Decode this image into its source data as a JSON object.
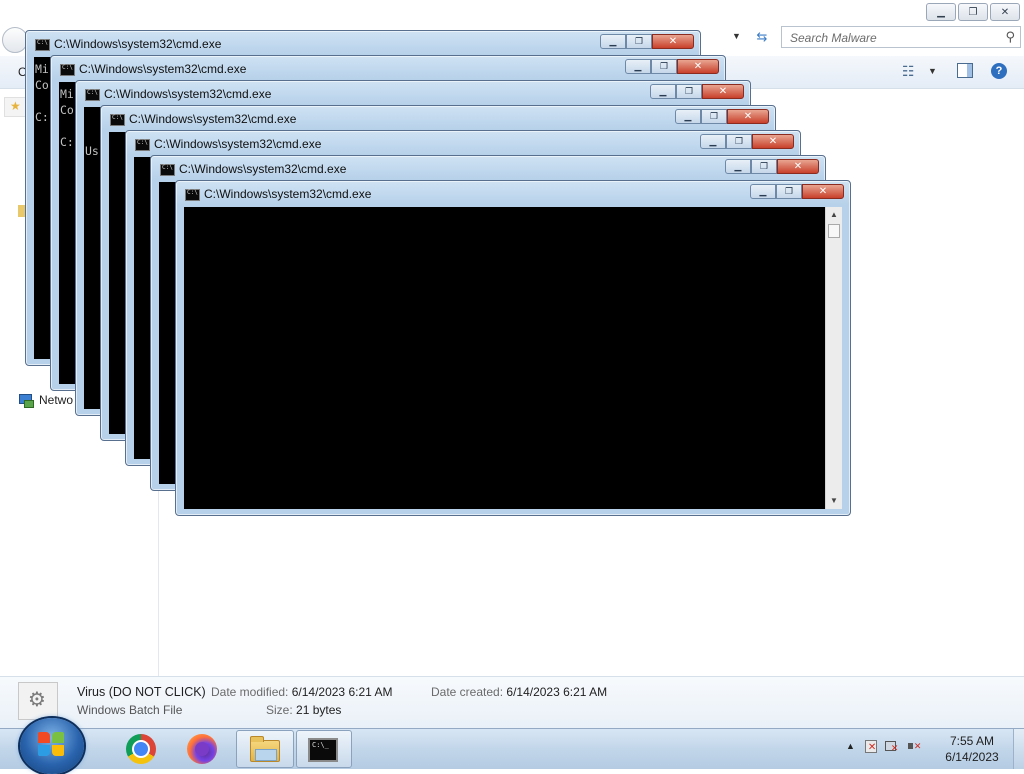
{
  "explorer": {
    "search_placeholder": "Search Malware",
    "toolbar_org": "O",
    "nav_network": "Netwo",
    "window_controls": {
      "minimize": "▁",
      "maximize": "❐",
      "close": "✕"
    },
    "details": {
      "name": "Virus (DO NOT CLICK)",
      "type": "Windows Batch File",
      "date_modified_label": "Date modified:",
      "date_modified": "6/14/2023 6:21 AM",
      "size_label": "Size:",
      "size": "21 bytes",
      "date_created_label": "Date created:",
      "date_created": "6/14/2023 6:21 AM"
    }
  },
  "cmd_windows": [
    {
      "title": "C:\\Windows\\system32\\cmd.exe",
      "lines": [
        "Mi",
        "Co",
        "",
        "C:"
      ]
    },
    {
      "title": "C:\\Windows\\system32\\cmd.exe",
      "lines": [
        "Mi",
        "Co",
        "",
        "C:"
      ]
    },
    {
      "title": "C:\\Windows\\system32\\cmd.exe",
      "lines": [
        "",
        "",
        "Us"
      ]
    },
    {
      "title": "C:\\Windows\\system32\\cmd.exe",
      "lines": []
    },
    {
      "title": "C:\\Windows\\system32\\cmd.exe",
      "lines": []
    },
    {
      "title": "C:\\Windows\\system32\\cmd.exe",
      "lines": []
    },
    {
      "title": "C:\\Windows\\system32\\cmd.exe",
      "lines": []
    }
  ],
  "cmd_controls": {
    "minimize": "▁",
    "maximize": "❐",
    "close": "✕"
  },
  "taskbar": {
    "apps": [
      {
        "name": "Google Chrome",
        "icon": "chrome-icon"
      },
      {
        "name": "Firefox",
        "icon": "firefox-icon"
      },
      {
        "name": "Windows Explorer",
        "icon": "folder-icon"
      },
      {
        "name": "Command Prompt",
        "icon": "cmd-icon"
      }
    ],
    "cmd_icon_text": "C:\\_",
    "clock_time": "7:55 AM",
    "clock_date": "6/14/2023"
  }
}
